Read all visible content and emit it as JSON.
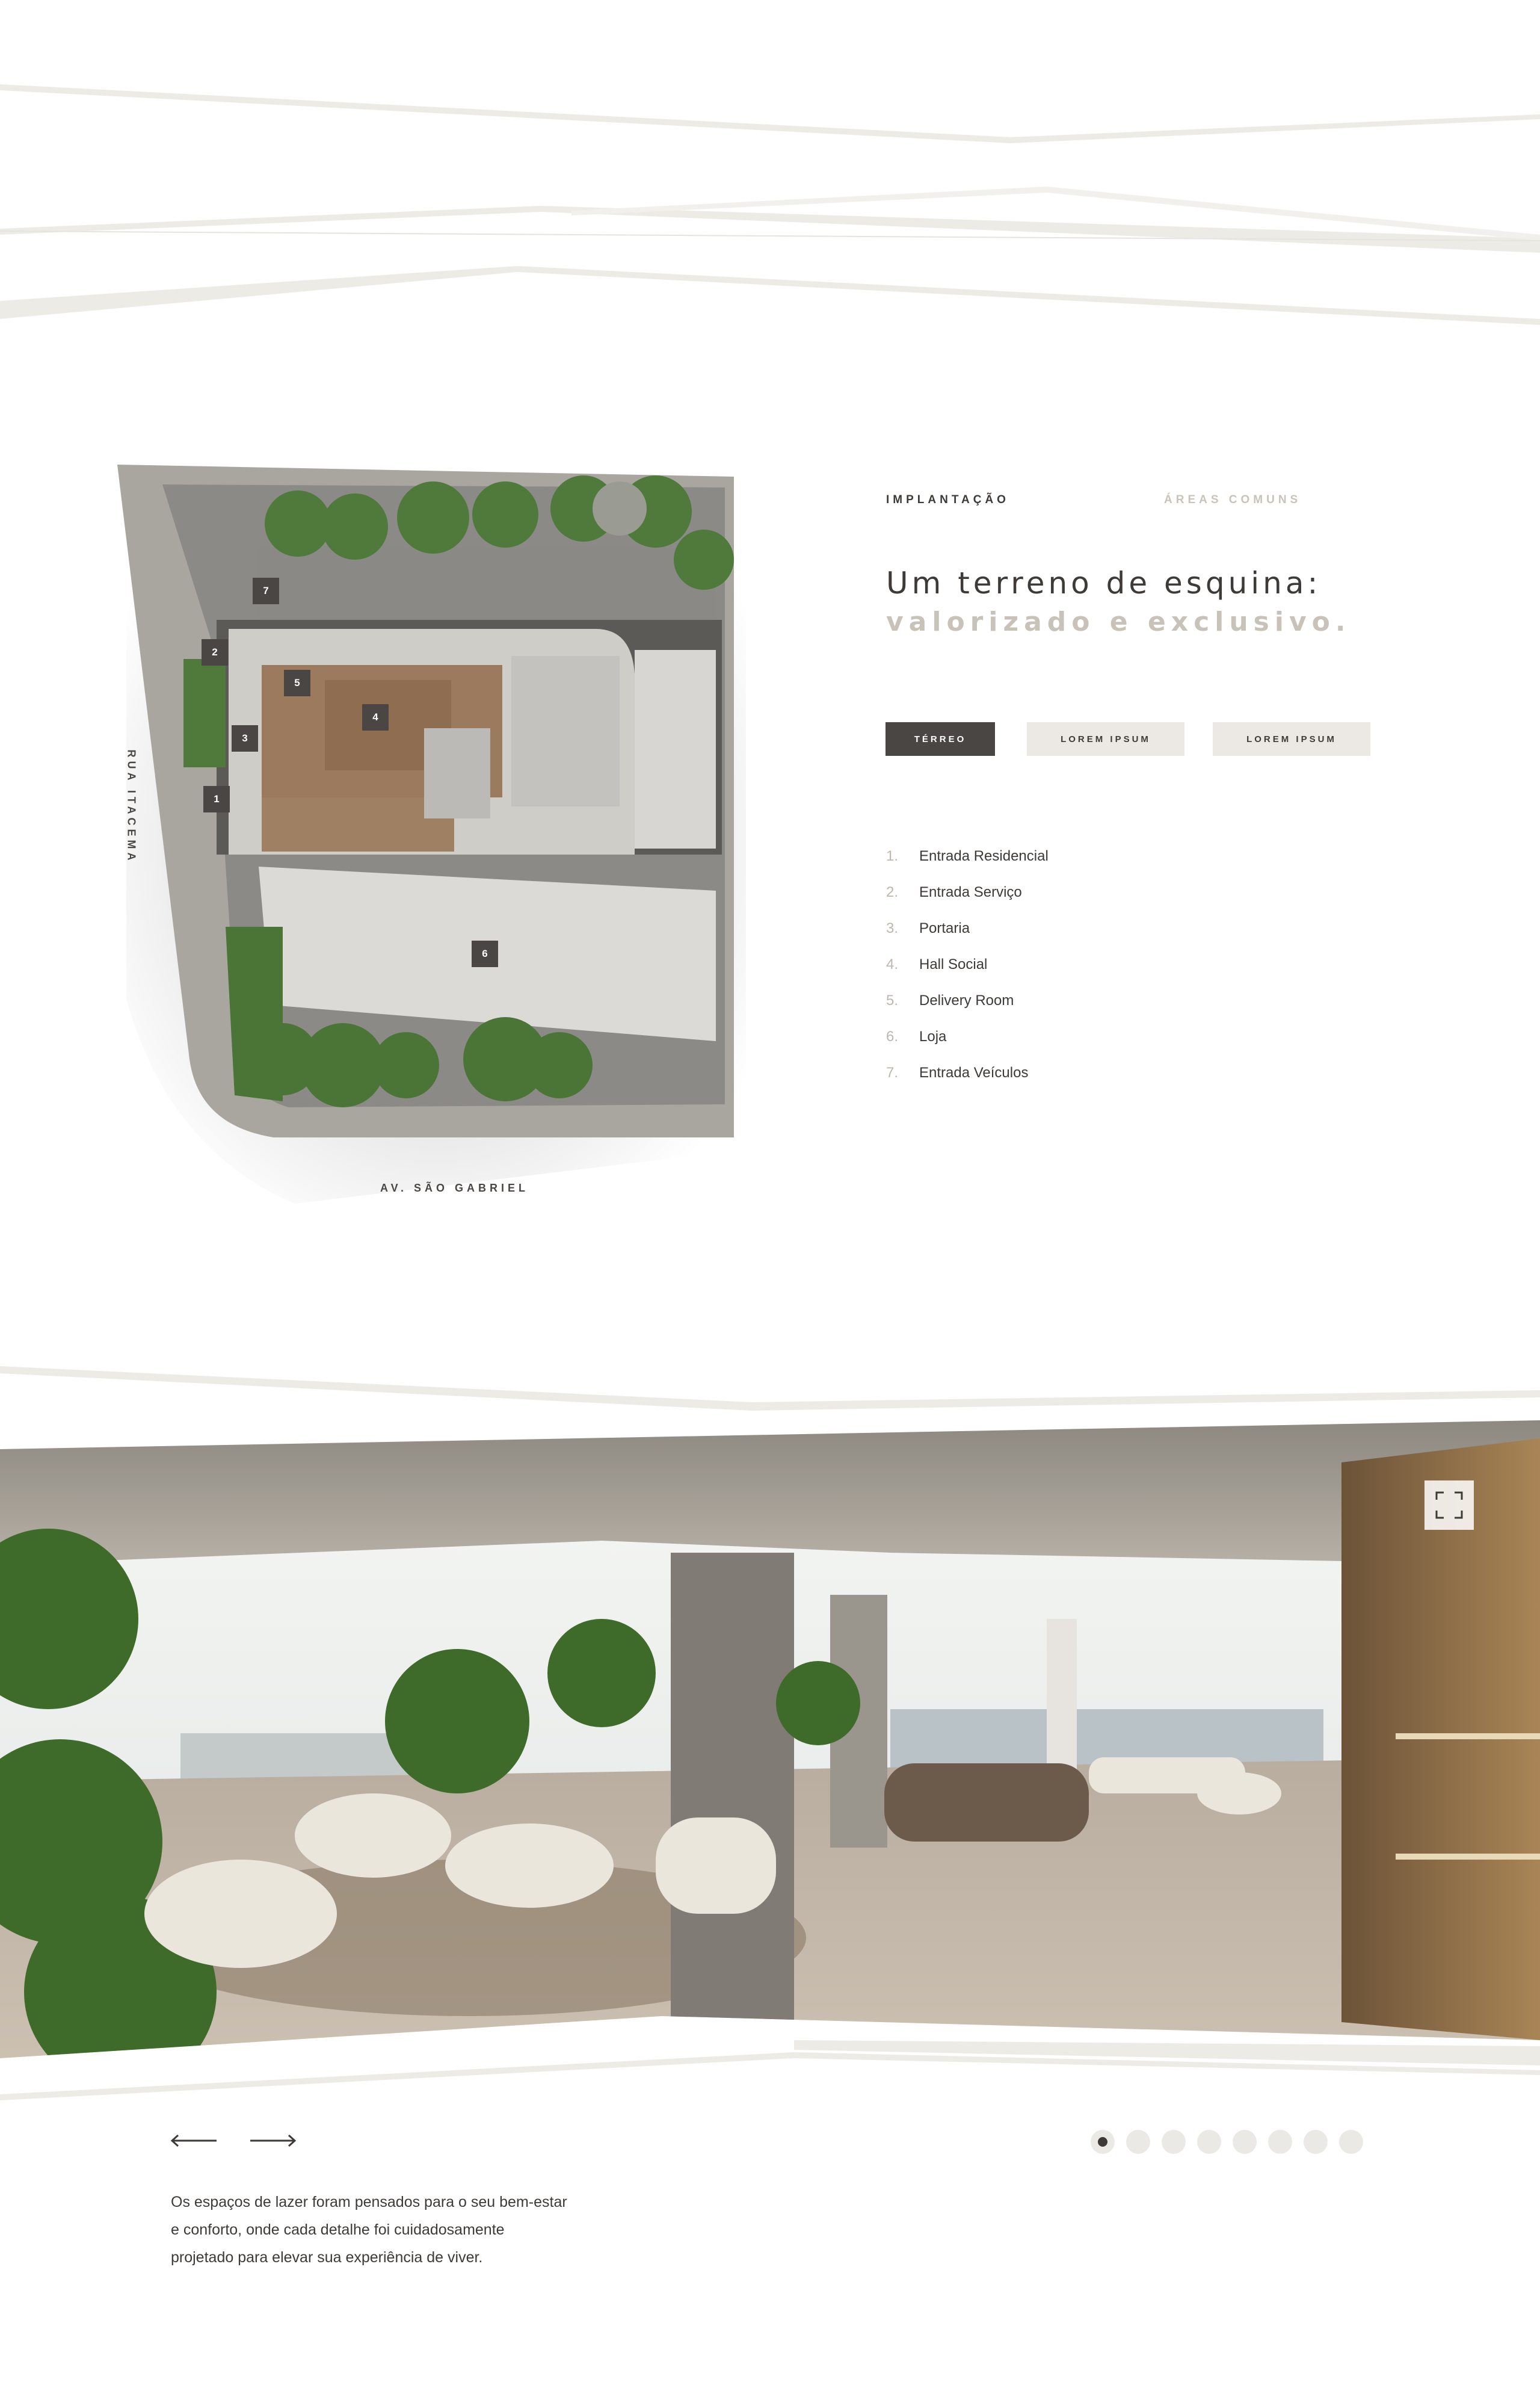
{
  "tabs": [
    {
      "label": "IMPLANTAÇÃO",
      "active": true
    },
    {
      "label": "ÁREAS COMUNS",
      "active": false
    }
  ],
  "headline": {
    "line1": "Um terreno de esquina:",
    "line2": "valorizado e exclusivo."
  },
  "floor_buttons": [
    {
      "label": "TÉRREO",
      "active": true
    },
    {
      "label": "LOREM IPSUM",
      "active": false
    },
    {
      "label": "LOREM IPSUM",
      "active": false
    }
  ],
  "legend": [
    {
      "num": "1.",
      "label": "Entrada Residencial"
    },
    {
      "num": "2.",
      "label": "Entrada Serviço"
    },
    {
      "num": "3.",
      "label": "Portaria"
    },
    {
      "num": "4.",
      "label": "Hall Social"
    },
    {
      "num": "5.",
      "label": "Delivery Room"
    },
    {
      "num": "6.",
      "label": "Loja"
    },
    {
      "num": "7.",
      "label": "Entrada Veículos"
    }
  ],
  "map_markers": [
    "1",
    "2",
    "3",
    "4",
    "5",
    "6",
    "7"
  ],
  "streets": {
    "side": "RUA ITACEMA",
    "bottom": "AV. SÃO GABRIEL"
  },
  "gallery": {
    "description_lines": [
      "Os espaços de lazer foram pensados para o seu bem-estar",
      "e conforto, onde cada detalhe foi cuidadosamente",
      "projetado para elevar sua experiência de viver."
    ],
    "slide_count": 8,
    "active_slide": 1
  },
  "icons": {
    "prev": "arrow-left-icon",
    "next": "arrow-right-icon",
    "expand": "fullscreen-icon"
  },
  "colors": {
    "dark": "#4a4644",
    "accent_light": "#c9c2b8",
    "stripe": "#ecebe6",
    "button_light": "#ece9e5"
  }
}
